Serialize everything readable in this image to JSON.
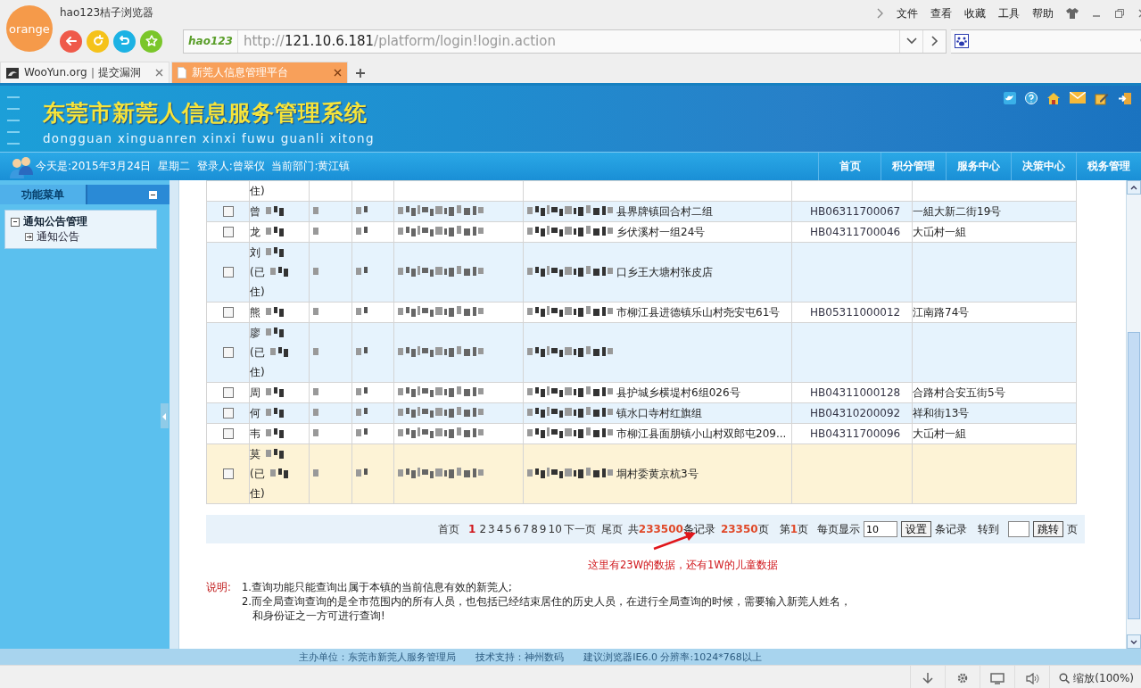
{
  "browser": {
    "logo": "orange",
    "title": "hao123桔子浏览器",
    "menu": [
      "文件",
      "查看",
      "收藏",
      "工具",
      "帮助"
    ],
    "address_logo": "hao123",
    "url": {
      "scheme": "http://",
      "host": "121.10.6.181",
      "path": "/platform/login!login.action"
    },
    "tabs": [
      {
        "label": "WooYun.org｜提交漏洞",
        "selected": false
      },
      {
        "label": "新莞人信息管理平台",
        "selected": true
      }
    ]
  },
  "header": {
    "title": "东莞市新莞人信息服务管理系统",
    "subtitle": "dongguan xinguanren xinxi fuwu guanli xitong"
  },
  "info_bar": {
    "text": "今天是:2015年3月24日  星期二  登录人:曾翠仪  当前部门:黄江镇",
    "nav": [
      "首页",
      "积分管理",
      "服务中心",
      "决策中心",
      "税务管理"
    ]
  },
  "sidebar": {
    "title": "功能菜单",
    "items": [
      {
        "label": "通知公告管理",
        "expanded": true,
        "children": [
          {
            "label": "通知公告",
            "expanded": false
          }
        ]
      }
    ]
  },
  "table": {
    "rows": [
      {
        "name_lines": [
          {
            "text": "住)",
            "masked": false
          }
        ],
        "masked": false
      },
      {
        "checked": false,
        "name_lines": [
          {
            "text": "曾",
            "masked": true
          }
        ],
        "masked": true,
        "address": "县界牌镇回合村二组",
        "code": "HB06311700067",
        "location": "一組大新二街19号"
      },
      {
        "checked": false,
        "name_lines": [
          {
            "text": "龙",
            "masked": true
          }
        ],
        "masked": true,
        "address": "乡伏溪村一组24号",
        "code": "HB04311700046",
        "location": "大屲村一組"
      },
      {
        "checked": false,
        "name_lines": [
          {
            "text": "刘",
            "masked": true
          },
          {
            "text": "(已",
            "masked": true
          },
          {
            "text": "住)",
            "masked": false
          }
        ],
        "masked": true,
        "address": "口乡王大塘村张皮店"
      },
      {
        "checked": false,
        "name_lines": [
          {
            "text": "熊",
            "masked": true
          }
        ],
        "masked": true,
        "address": "市柳江县进德镇乐山村尧安屯61号",
        "code": "HB05311000012",
        "location": "江南路74号"
      },
      {
        "checked": false,
        "name_lines": [
          {
            "text": "廖",
            "masked": true
          },
          {
            "text": "(已",
            "masked": true
          },
          {
            "text": "住)",
            "masked": false
          }
        ],
        "masked": true
      },
      {
        "checked": false,
        "name_lines": [
          {
            "text": "周",
            "masked": true
          }
        ],
        "masked": true,
        "address": "县护城乡横堤村6组026号",
        "code": "HB04311000128",
        "location": "合路村合安五街5号"
      },
      {
        "checked": false,
        "name_lines": [
          {
            "text": "何",
            "masked": true
          }
        ],
        "masked": true,
        "address": "镇水口寺村红旗组",
        "code": "HB04310200092",
        "location": "祥和街13号"
      },
      {
        "checked": false,
        "name_lines": [
          {
            "text": "韦",
            "masked": true
          }
        ],
        "masked": true,
        "address": "市柳江县面朋镇小山村双郎屯209...",
        "code": "HB04311700096",
        "location": "大屲村一組"
      },
      {
        "checked": false,
        "highlighted": true,
        "name_lines": [
          {
            "text": "莫",
            "masked": true
          },
          {
            "text": "(已",
            "masked": true
          },
          {
            "text": "住)",
            "masked": false
          }
        ],
        "masked": true,
        "address": "垌村委黄京杭3号"
      }
    ]
  },
  "pager": {
    "first": "首页",
    "pages": [
      {
        "label": "1",
        "selected": true
      },
      {
        "label": "2",
        "selected": false
      },
      {
        "label": "3",
        "selected": false
      },
      {
        "label": "4",
        "selected": false
      },
      {
        "label": "5",
        "selected": false
      },
      {
        "label": "6",
        "selected": false
      },
      {
        "label": "7",
        "selected": false
      },
      {
        "label": "8",
        "selected": false
      },
      {
        "label": "9",
        "selected": false
      },
      {
        "label": "10",
        "selected": false
      }
    ],
    "next": "下一页",
    "last": "尾页",
    "total_prefix": "共",
    "total": "233500",
    "total_suffix": "条记录",
    "page_count": "23350",
    "page_count_suffix": "页",
    "current_prefix": "第",
    "current": "1",
    "current_suffix": "页",
    "per_page_label": "每页显示",
    "per_page": "10",
    "set_button": "设置",
    "per_page_suffix": "条记录",
    "goto_label": "转到",
    "goto_button": "跳转",
    "goto_suffix": "页"
  },
  "annotation": "这里有23W的数据，还有1W的儿童数据",
  "notes": {
    "label": "说明:",
    "lines": [
      "1.查询功能只能查询出属于本镇的当前信息有效的新莞人;",
      "2.而全局查询查询的是全市范围内的所有人员，也包括已经结束居住的历史人员，在进行全局查询的时候，需要输入新莞人姓名，",
      "和身份证之一方可进行查询!"
    ]
  },
  "footer": [
    "主办单位：东莞市新莞人服务管理局",
    "技术支持：神州数码",
    "建议浏览器IE6.0 分辨率:1024*768以上"
  ],
  "status_bar": {
    "zoom": "缩放(100%)"
  }
}
